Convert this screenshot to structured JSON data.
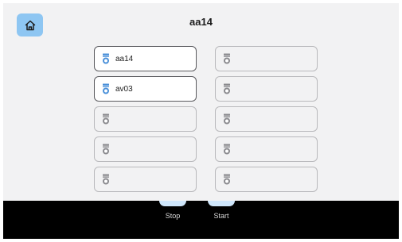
{
  "header": {
    "title": "aa14"
  },
  "slots": [
    {
      "label": "aa14",
      "filled": true
    },
    {
      "label": "",
      "filled": false
    },
    {
      "label": "av03",
      "filled": true
    },
    {
      "label": "",
      "filled": false
    },
    {
      "label": "",
      "filled": false
    },
    {
      "label": "",
      "filled": false
    },
    {
      "label": "",
      "filled": false
    },
    {
      "label": "",
      "filled": false
    },
    {
      "label": "",
      "filled": false
    },
    {
      "label": "",
      "filled": false
    }
  ],
  "bottom_bar": {
    "stop_label": "Stop",
    "start_label": "Start"
  },
  "icons": {
    "home": "home-icon",
    "slot": "device-icon"
  },
  "colors": {
    "accent": "#8ec6f2",
    "icon_active": "#4a90d9",
    "icon_inactive": "#8a8a8e",
    "bar": "#000000"
  }
}
